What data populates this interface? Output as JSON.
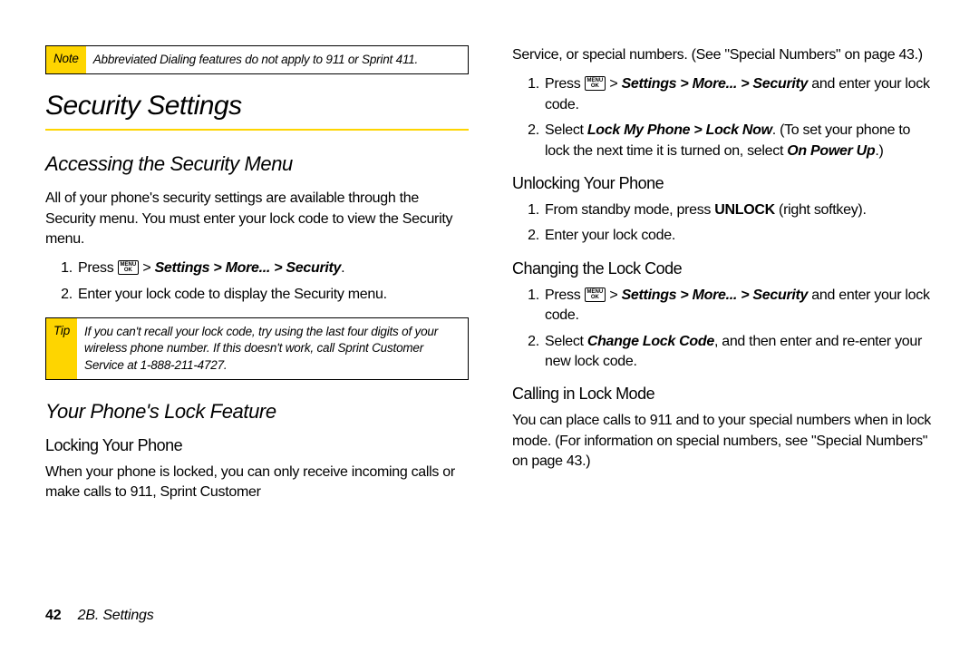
{
  "note": {
    "label": "Note",
    "text": "Abbreviated Dialing features do not apply to 911 or Sprint 411."
  },
  "h1": "Security Settings",
  "accessing": {
    "title": "Accessing the Security Menu",
    "intro": "All of your phone's security settings are available through the Security menu. You must enter your lock code to view the Security menu.",
    "step1_prefix": "Press ",
    "step1_key": "MENU\nOK",
    "step1_gt": " > ",
    "step1_path": "Settings > More... > Security",
    "step1_suffix": ".",
    "step2": "Enter your lock code to display the Security menu."
  },
  "tip": {
    "label": "Tip",
    "text": "If you can't recall your lock code, try using the last four digits of your wireless phone number. If this doesn't work, call Sprint Customer Service at 1-888-211-4727."
  },
  "lockfeature": {
    "title": "Your Phone's Lock Feature",
    "locking_title": "Locking Your Phone",
    "locking_body": "When your phone is locked, you can only receive incoming calls or make calls to 911, Sprint Customer"
  },
  "rightcol": {
    "cont1": "Service, or special numbers. (See \"Special Numbers\" on page 43.)",
    "lock_step1_prefix": "Press ",
    "lock_step1_key": "MENU\nOK",
    "lock_step1_gt": " > ",
    "lock_step1_path": "Settings > More... > Security",
    "lock_step1_suffix": " and enter your lock code.",
    "lock_step2_a": "Select ",
    "lock_step2_b": "Lock My Phone > Lock Now",
    "lock_step2_c": ". (To set your phone to lock the next time it is turned on, select ",
    "lock_step2_d": "On Power Up",
    "lock_step2_e": ".)",
    "unlock_title": "Unlocking Your Phone",
    "unlock_step1_a": "From standby mode, press ",
    "unlock_step1_b": "UNLOCK",
    "unlock_step1_c": " (right softkey).",
    "unlock_step2": "Enter your lock code.",
    "change_title": "Changing the Lock Code",
    "change_step1_prefix": "Press ",
    "change_step1_key": "MENU\nOK",
    "change_step1_gt": " > ",
    "change_step1_path": "Settings > More... > Security",
    "change_step1_suffix": " and enter your lock code.",
    "change_step2_a": "Select ",
    "change_step2_b": "Change Lock Code",
    "change_step2_c": ", and then enter and re-enter your new lock code.",
    "callmode_title": "Calling in Lock Mode",
    "callmode_body": "You can place calls to 911 and to your special numbers when in lock mode. (For information on special numbers, see \"Special Numbers\" on page 43.)"
  },
  "footer": {
    "page": "42",
    "section": "2B. Settings"
  }
}
